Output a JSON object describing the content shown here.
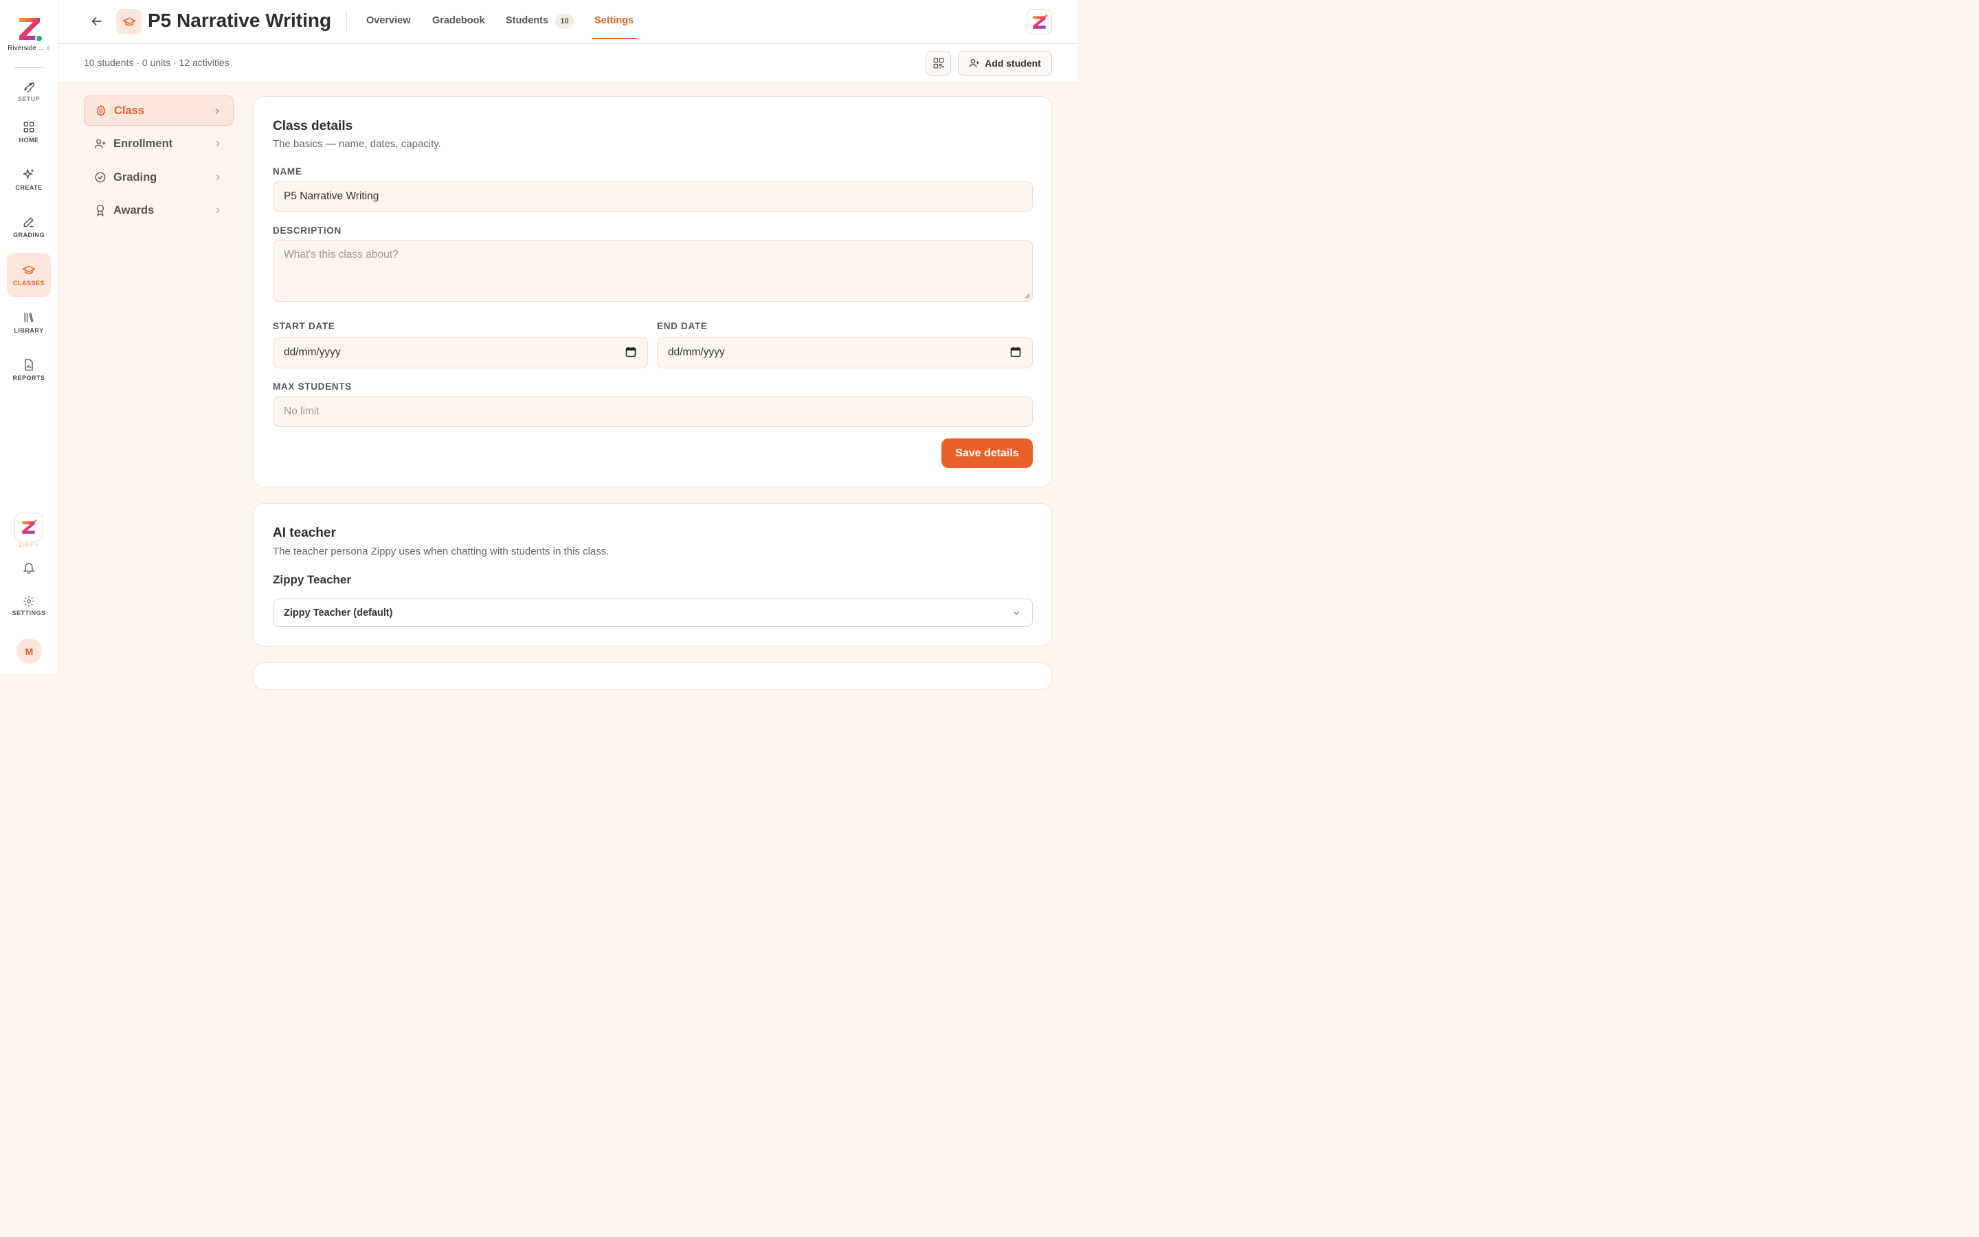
{
  "rail": {
    "org_name": "Riverside ...",
    "items": [
      {
        "label": "SETUP",
        "icon": "rocket-icon"
      },
      {
        "label": "HOME",
        "icon": "grid-icon"
      },
      {
        "label": "CREATE",
        "icon": "sparkles-icon"
      },
      {
        "label": "GRADING",
        "icon": "pencil-icon"
      },
      {
        "label": "CLASSES",
        "icon": "graduation-cap-icon"
      },
      {
        "label": "LIBRARY",
        "icon": "books-icon"
      },
      {
        "label": "REPORTS",
        "icon": "report-icon"
      }
    ],
    "zippy_label": "ZIPPY",
    "settings_label": "SETTINGS",
    "avatar_initial": "M"
  },
  "header": {
    "title": "P5 Narrative Writing",
    "tabs": [
      {
        "label": "Overview"
      },
      {
        "label": "Gradebook"
      },
      {
        "label": "Students"
      },
      {
        "label": "Settings"
      }
    ],
    "students_count": "10",
    "active_tab": "Settings"
  },
  "subheader": {
    "stats": "10 students · 0 units · 12 activities",
    "add_student_label": "Add student"
  },
  "settings_menu": {
    "items": [
      {
        "label": "Class",
        "icon": "gear-icon"
      },
      {
        "label": "Enrollment",
        "icon": "user-plus-icon"
      },
      {
        "label": "Grading",
        "icon": "check-circle-icon"
      },
      {
        "label": "Awards",
        "icon": "award-icon"
      }
    ],
    "active": "Class"
  },
  "class_details": {
    "title": "Class details",
    "subtitle": "The basics — name, dates, capacity.",
    "name_label": "NAME",
    "name_value": "P5 Narrative Writing",
    "description_label": "DESCRIPTION",
    "description_placeholder": "What's this class about?",
    "start_date_label": "START DATE",
    "start_date_value": "dd/mm/yyyy",
    "end_date_label": "END DATE",
    "end_date_value": "dd/mm/yyyy",
    "max_students_label": "MAX STUDENTS",
    "max_students_placeholder": "No limit",
    "save_label": "Save details"
  },
  "ai_teacher": {
    "title": "AI teacher",
    "subtitle": "The teacher persona Zippy uses when chatting with students in this class.",
    "persona_label": "Zippy Teacher",
    "selected": "Zippy Teacher (default)"
  },
  "colors": {
    "accent": "#e8602c",
    "accent_soft": "#fde6dc",
    "background": "#fdf6ef",
    "online": "#1fb37a"
  }
}
